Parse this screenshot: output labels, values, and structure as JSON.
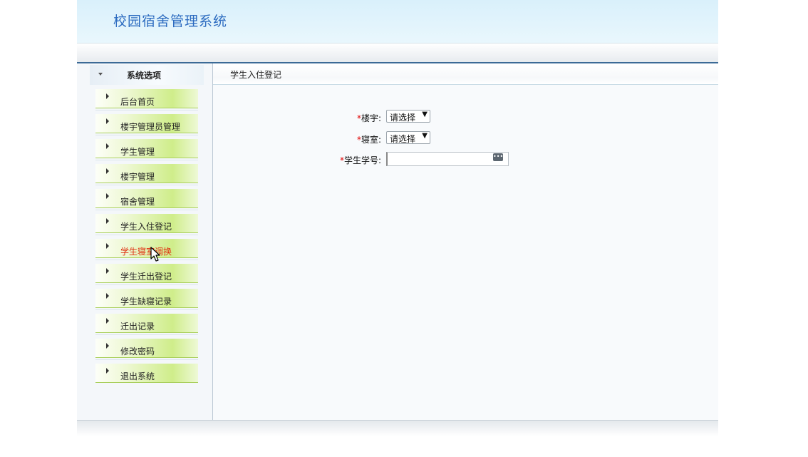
{
  "app": {
    "title": "校园宿舍管理系统"
  },
  "sidebar": {
    "title": "系统选项",
    "items": [
      {
        "label": "后台首页"
      },
      {
        "label": "楼宇管理员管理"
      },
      {
        "label": "学生管理"
      },
      {
        "label": "楼宇管理"
      },
      {
        "label": "宿舍管理"
      },
      {
        "label": "学生入住登记"
      },
      {
        "label": "学生寝室调换"
      },
      {
        "label": "学生迁出登记"
      },
      {
        "label": "学生缺寝记录"
      },
      {
        "label": "迁出记录"
      },
      {
        "label": "修改密码"
      },
      {
        "label": "退出系统"
      }
    ]
  },
  "content": {
    "title": "学生入住登记",
    "form": {
      "required_mark": "*",
      "building_label": "楼宇:",
      "building_value": "请选择",
      "room_label": "寝室:",
      "room_value": "请选择",
      "student_id_label": "学生学号:",
      "student_id_value": ""
    }
  },
  "colors": {
    "title_blue": "#2c6bc0",
    "menu_green": "#cfed8a",
    "highlight_red": "#e03010",
    "required_red": "#e00000"
  },
  "icons": [
    "collapse-arrow-icon",
    "menu-triangle-icon",
    "lookup-icon",
    "mouse-cursor-icon"
  ]
}
